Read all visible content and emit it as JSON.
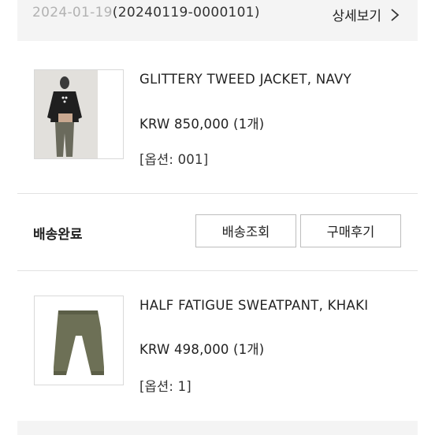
{
  "order": {
    "date": "2024-01-19",
    "id": "(20240119-0000101)",
    "detail_link": "상세보기"
  },
  "items": [
    {
      "name": "GLITTERY TWEED JACKET, NAVY",
      "price": "KRW 850,000 (1개)",
      "option": "[옵션: 001]"
    },
    {
      "name": "HALF FATIGUE SWEATPANT, KHAKI",
      "price": "KRW 498,000 (1개)",
      "option": "[옵션: 1]"
    }
  ],
  "shipping": {
    "status": "배송완료",
    "track_button": "배송조회",
    "review_button": "구매후기"
  },
  "icons": {
    "detail": "chevron-right-icon"
  }
}
